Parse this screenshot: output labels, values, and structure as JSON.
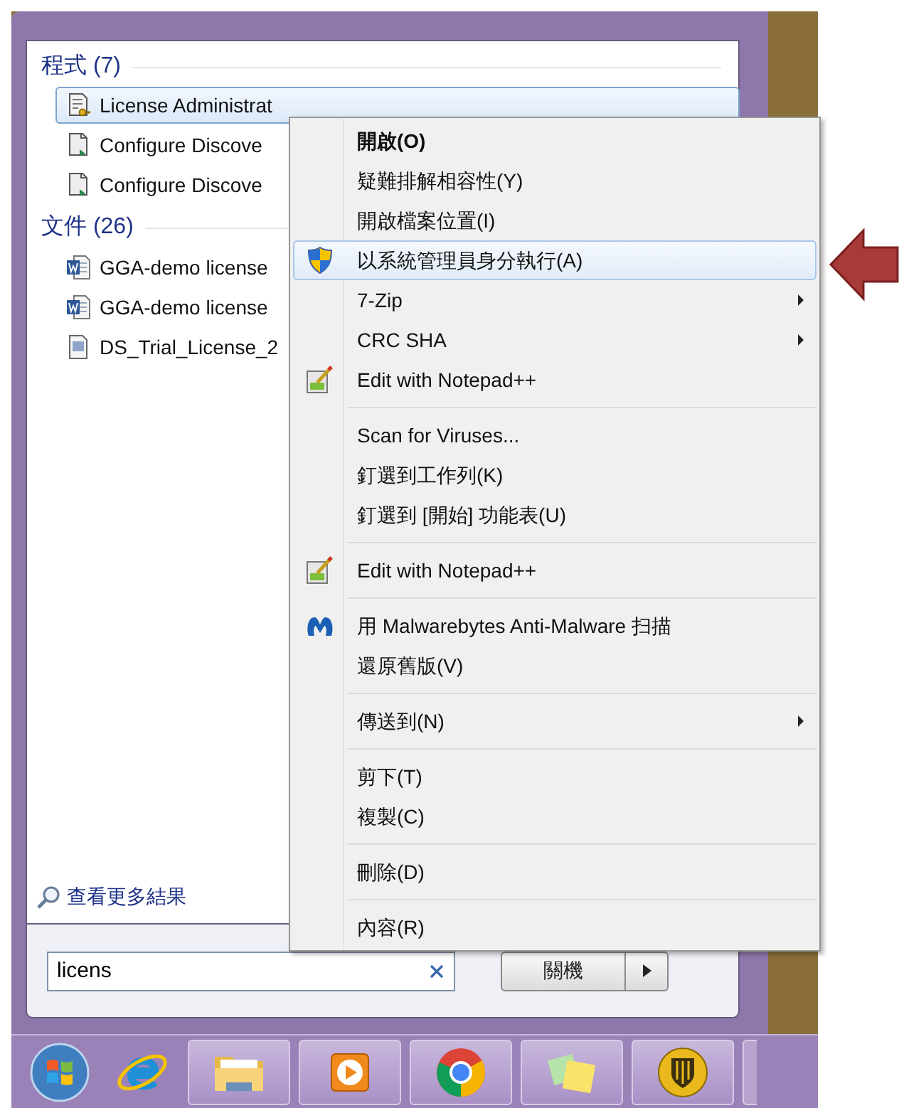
{
  "start_menu": {
    "sections": [
      {
        "title": "程式 (7)",
        "items": [
          {
            "label": "License Administrat",
            "kind": "key-doc",
            "selected": true
          },
          {
            "label": "Configure Discove",
            "kind": "app-doc",
            "selected": false
          },
          {
            "label": "Configure Discove",
            "kind": "app-doc",
            "selected": false
          }
        ]
      },
      {
        "title": "文件 (26)",
        "items": [
          {
            "label": "GGA-demo license",
            "kind": "word",
            "selected": false
          },
          {
            "label": "GGA-demo license",
            "kind": "word",
            "selected": false
          },
          {
            "label": "DS_Trial_License_2",
            "kind": "text",
            "selected": false
          }
        ]
      }
    ],
    "more_results": "查看更多結果",
    "search": {
      "value": "licens"
    },
    "shutdown_button": "關機"
  },
  "context_menu": [
    {
      "kind": "plain",
      "label": "開啟(O)",
      "default": true,
      "selected": false,
      "submenu": false
    },
    {
      "kind": "plain",
      "label": "疑難排解相容性(Y)",
      "default": false,
      "selected": false,
      "submenu": false
    },
    {
      "kind": "plain",
      "label": "開啟檔案位置(I)",
      "default": false,
      "selected": false,
      "submenu": false
    },
    {
      "kind": "shield",
      "label": "以系統管理員身分執行(A)",
      "default": false,
      "selected": true,
      "submenu": false
    },
    {
      "kind": "plain",
      "label": "7-Zip",
      "default": false,
      "selected": false,
      "submenu": true
    },
    {
      "kind": "plain",
      "label": "CRC SHA",
      "default": false,
      "selected": false,
      "submenu": true
    },
    {
      "kind": "notepad",
      "label": "Edit with Notepad++",
      "default": false,
      "selected": false,
      "submenu": false
    },
    {
      "kind": "separator"
    },
    {
      "kind": "plain",
      "label": "Scan for Viruses...",
      "default": false,
      "selected": false,
      "submenu": false
    },
    {
      "kind": "plain",
      "label": "釘選到工作列(K)",
      "default": false,
      "selected": false,
      "submenu": false
    },
    {
      "kind": "plain",
      "label": "釘選到 [開始] 功能表(U)",
      "default": false,
      "selected": false,
      "submenu": false
    },
    {
      "kind": "separator"
    },
    {
      "kind": "notepad",
      "label": "Edit with Notepad++",
      "default": false,
      "selected": false,
      "submenu": false
    },
    {
      "kind": "separator"
    },
    {
      "kind": "malwarebytes",
      "label": "用 Malwarebytes Anti-Malware 扫描",
      "default": false,
      "selected": false,
      "submenu": false
    },
    {
      "kind": "plain",
      "label": "還原舊版(V)",
      "default": false,
      "selected": false,
      "submenu": false
    },
    {
      "kind": "separator"
    },
    {
      "kind": "plain",
      "label": "傳送到(N)",
      "default": false,
      "selected": false,
      "submenu": true
    },
    {
      "kind": "separator"
    },
    {
      "kind": "plain",
      "label": "剪下(T)",
      "default": false,
      "selected": false,
      "submenu": false
    },
    {
      "kind": "plain",
      "label": "複製(C)",
      "default": false,
      "selected": false,
      "submenu": false
    },
    {
      "kind": "separator"
    },
    {
      "kind": "plain",
      "label": "刪除(D)",
      "default": false,
      "selected": false,
      "submenu": false
    },
    {
      "kind": "separator"
    },
    {
      "kind": "plain",
      "label": "內容(R)",
      "default": false,
      "selected": false,
      "submenu": false
    }
  ],
  "taskbar": [
    {
      "kind": "start"
    },
    {
      "kind": "browser-e"
    },
    {
      "kind": "folder"
    },
    {
      "kind": "media"
    },
    {
      "kind": "chrome"
    },
    {
      "kind": "notes"
    },
    {
      "kind": "shield"
    },
    {
      "kind": "partial"
    }
  ]
}
